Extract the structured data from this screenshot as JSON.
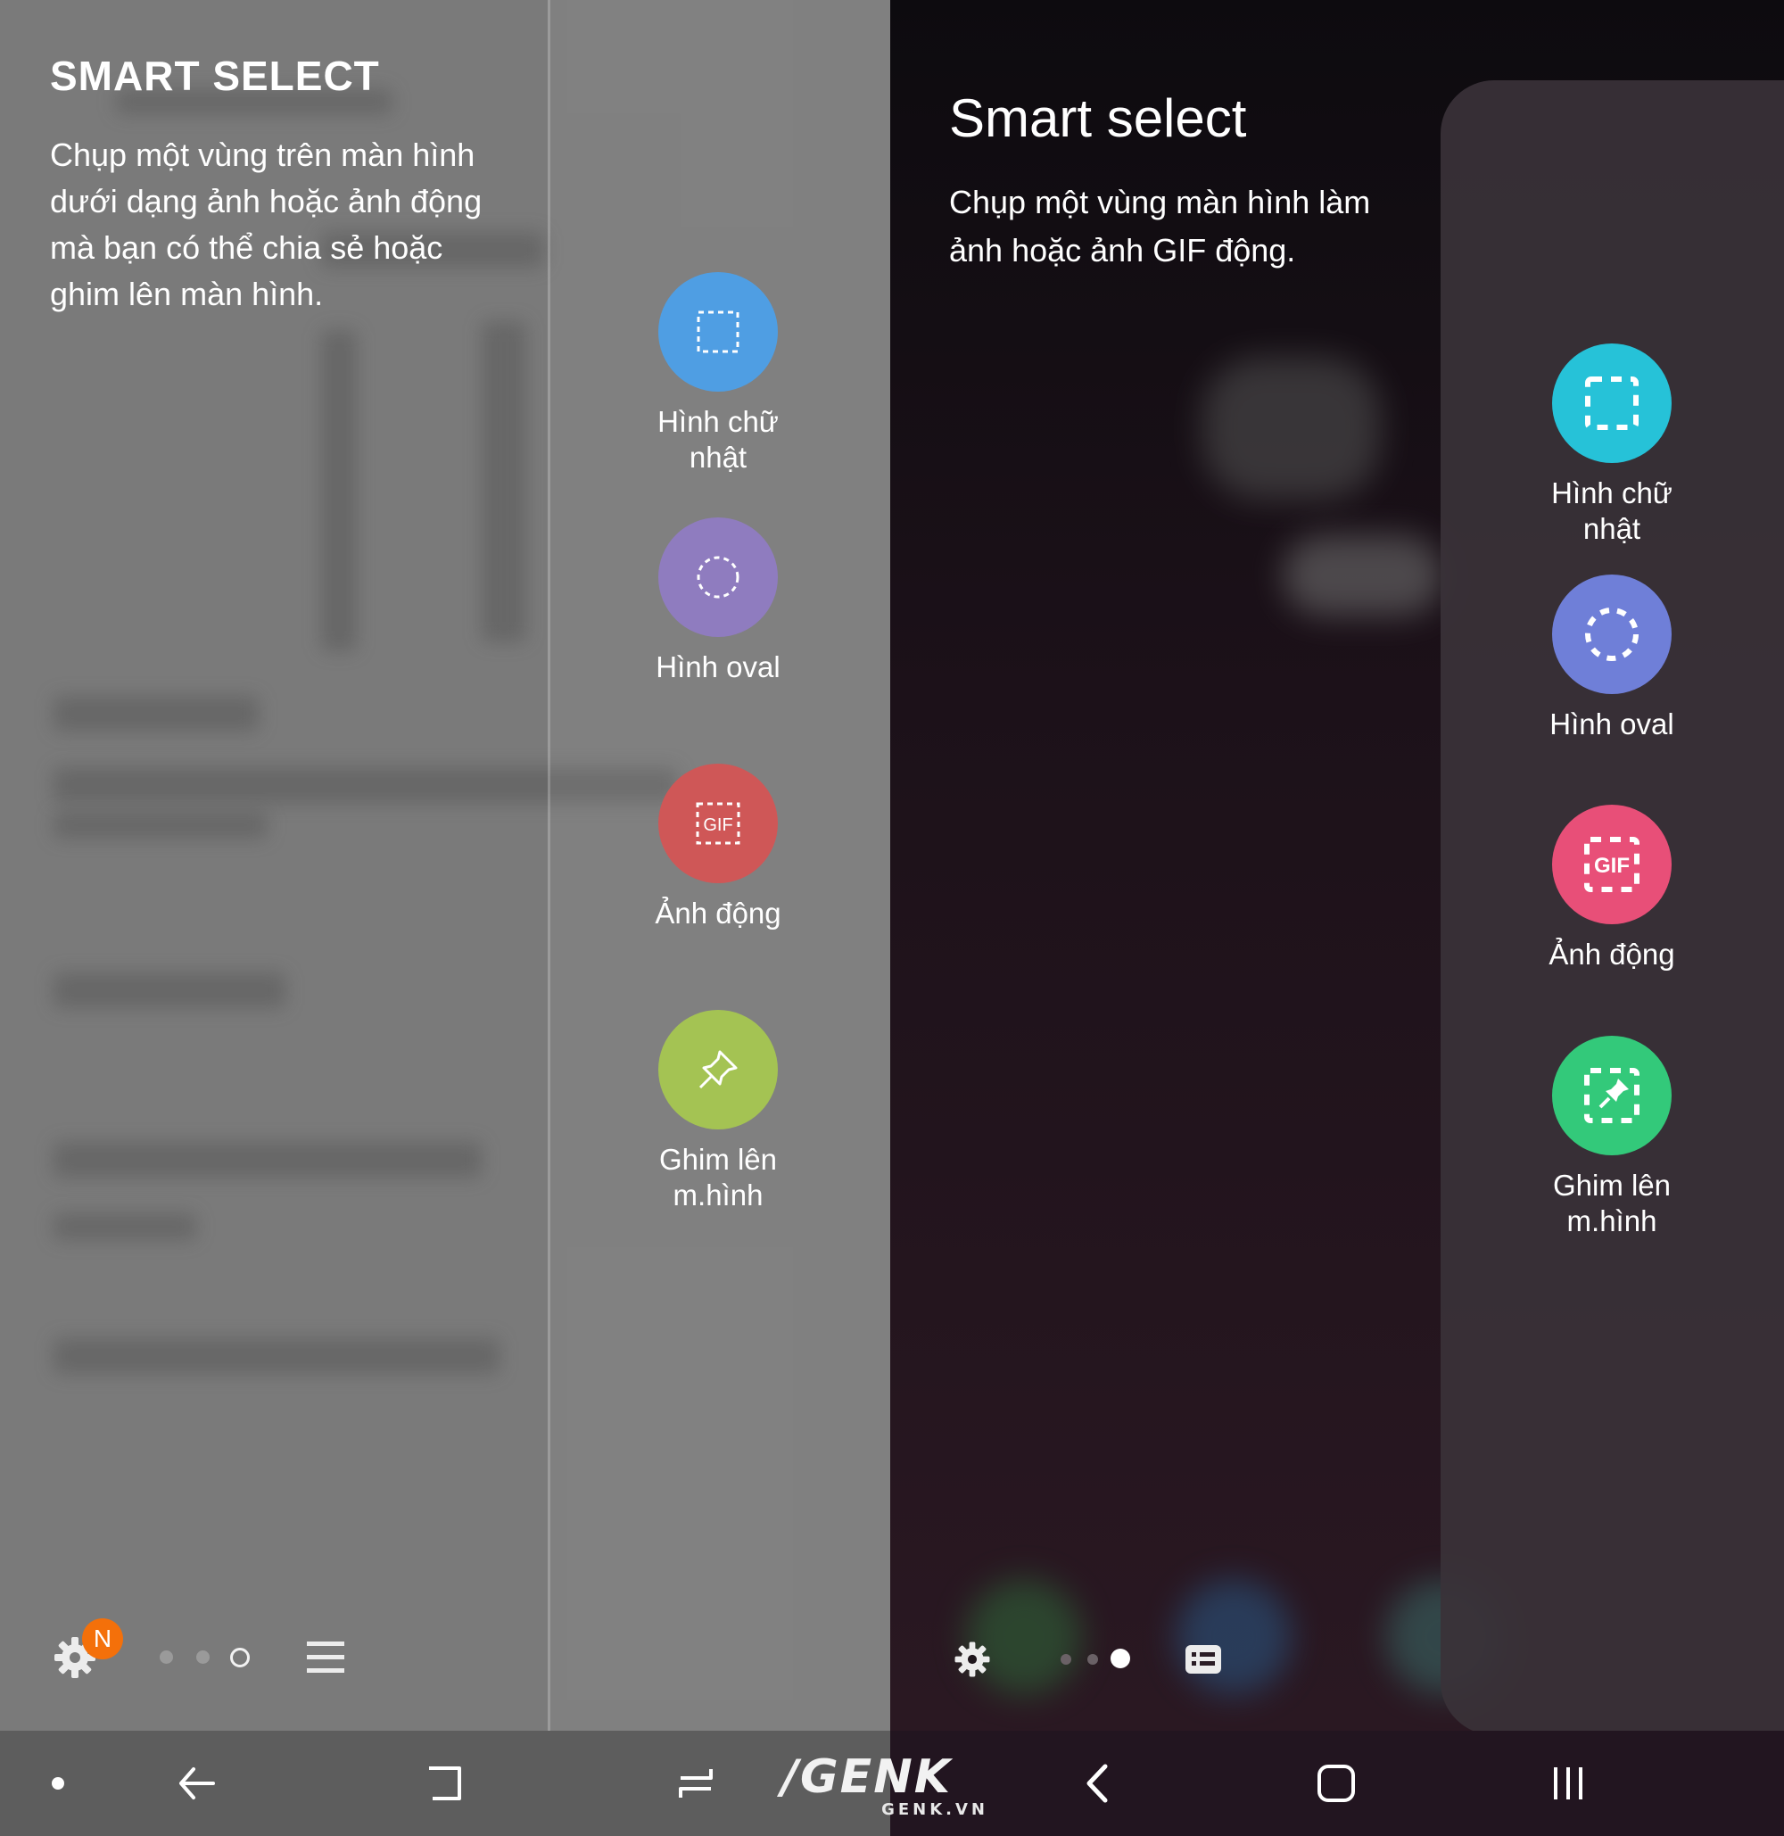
{
  "left_panel": {
    "title": "SMART SELECT",
    "description": "Chụp một vùng trên màn hình dưới dạng ảnh hoặc ảnh động mà bạn có thể chia sẻ hoặc ghim lên màn hình.",
    "tools": [
      {
        "label": "Hình chữ nhật",
        "icon": "rectangle-select-icon",
        "color": "#4f9ee3"
      },
      {
        "label": "Hình oval",
        "icon": "oval-select-icon",
        "color": "#8f7cbf"
      },
      {
        "label": "Ảnh động",
        "icon": "gif-icon",
        "color": "#cf5757"
      },
      {
        "label": "Ghim lên m.hình",
        "icon": "pin-icon",
        "color": "#a4c353"
      }
    ],
    "badge": "N",
    "page_indicator": {
      "total": 3,
      "current": 3
    }
  },
  "right_panel": {
    "title": "Smart select",
    "description": "Chụp một vùng màn hình làm ảnh hoặc ảnh GIF động.",
    "tools": [
      {
        "label": "Hình chữ nhật",
        "icon": "rectangle-select-icon",
        "color": "#26c2d8"
      },
      {
        "label": "Hình oval",
        "icon": "oval-select-icon",
        "color": "#6f7fd8"
      },
      {
        "label": "Ảnh động",
        "icon": "gif-icon",
        "color": "#e84f78"
      },
      {
        "label": "Ghim lên m.hình",
        "icon": "pin-icon",
        "color": "#33c97a"
      }
    ],
    "page_indicator": {
      "total": 3,
      "current": 3
    }
  },
  "watermark": {
    "brand": "/GENK",
    "site": "GENK.VN"
  },
  "colors": {
    "badge": "#f4700a",
    "left_bg": "#7a7a7a",
    "right_bg": "#1c1119"
  }
}
